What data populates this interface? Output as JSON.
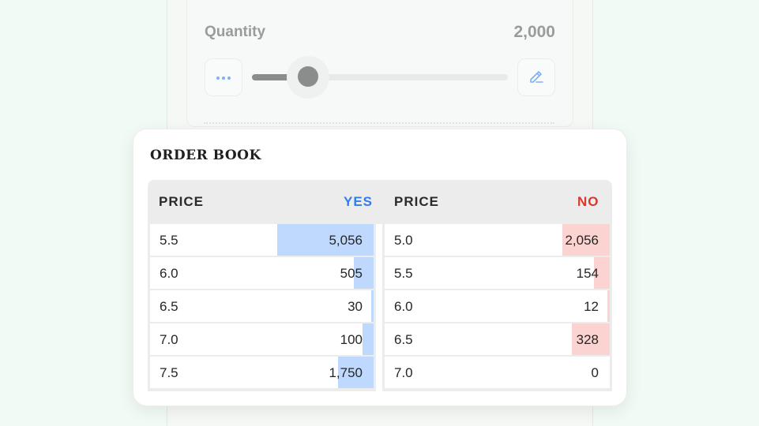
{
  "quantity": {
    "label": "Quantity",
    "value": "2,000",
    "slider_fraction": 0.22
  },
  "order_book": {
    "title": "ORDER BOOK",
    "yes": {
      "price_header": "PRICE",
      "side_header": "YES",
      "color": "#2f7df0",
      "bar_color": "#bfd9fe",
      "rows": [
        {
          "price": "5.5",
          "amount": "5,056",
          "depth": 0.43
        },
        {
          "price": "6.0",
          "amount": "505",
          "depth": 0.09
        },
        {
          "price": "6.5",
          "amount": "30",
          "depth": 0.01
        },
        {
          "price": "7.0",
          "amount": "100",
          "depth": 0.05
        },
        {
          "price": "7.5",
          "amount": "1,750",
          "depth": 0.16
        }
      ]
    },
    "no": {
      "price_header": "PRICE",
      "side_header": "NO",
      "color": "#d9372b",
      "bar_color": "#fbd3d0",
      "rows": [
        {
          "price": "5.0",
          "amount": "2,056",
          "depth": 0.21
        },
        {
          "price": "5.5",
          "amount": "154",
          "depth": 0.07
        },
        {
          "price": "6.0",
          "amount": "12",
          "depth": 0.01
        },
        {
          "price": "6.5",
          "amount": "328",
          "depth": 0.17
        },
        {
          "price": "7.0",
          "amount": "0",
          "depth": 0.0
        }
      ]
    }
  }
}
